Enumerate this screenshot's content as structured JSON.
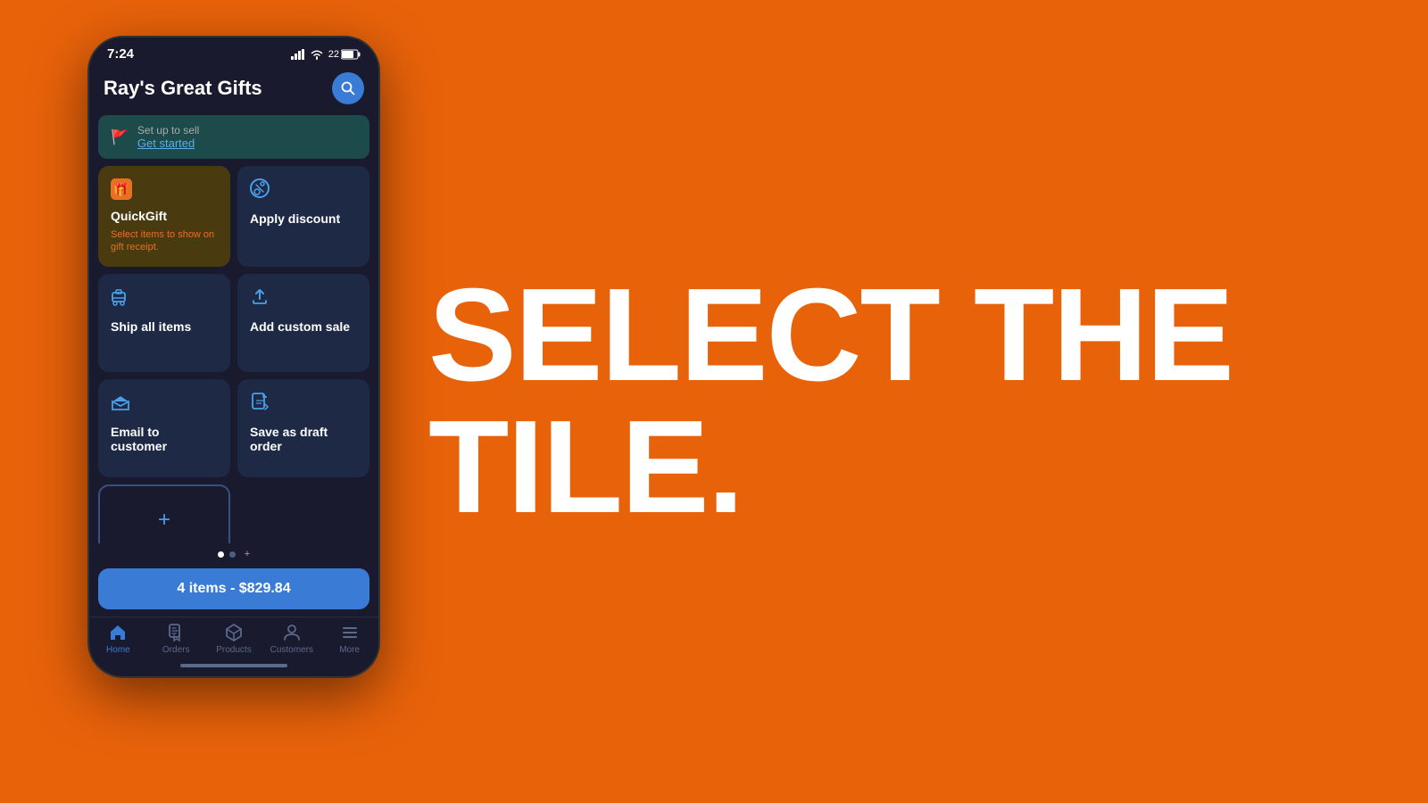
{
  "background_color": "#E8620A",
  "big_text": {
    "line1": "SELECT THE",
    "line2": "TILE."
  },
  "phone": {
    "status_bar": {
      "time": "7:24",
      "battery": "22"
    },
    "header": {
      "title": "Ray's Great Gifts",
      "search_label": "search"
    },
    "setup_banner": {
      "title": "Set up to sell",
      "link": "Get started"
    },
    "tiles": [
      {
        "id": "quick-gift",
        "icon": "gift",
        "title": "QuickGift",
        "subtitle": "Select items to show on gift receipt.",
        "variant": "quick-gift"
      },
      {
        "id": "apply-discount",
        "icon": "discount",
        "title": "Apply discount",
        "subtitle": ""
      },
      {
        "id": "ship-all-items",
        "icon": "ship",
        "title": "Ship all items",
        "subtitle": ""
      },
      {
        "id": "add-custom-sale",
        "icon": "upload",
        "title": "Add custom sale",
        "subtitle": ""
      },
      {
        "id": "email-to-customer",
        "icon": "email",
        "title": "Email to customer",
        "subtitle": ""
      },
      {
        "id": "save-as-draft",
        "icon": "draft",
        "title": "Save as draft order",
        "subtitle": ""
      }
    ],
    "add_tile_label": "+",
    "cart_button": "4 items - $829.84",
    "pagination": {
      "dots": 2,
      "active": 0
    },
    "bottom_nav": [
      {
        "id": "home",
        "label": "Home",
        "active": true,
        "icon": "home"
      },
      {
        "id": "orders",
        "label": "Orders",
        "active": false,
        "icon": "orders"
      },
      {
        "id": "products",
        "label": "Products",
        "active": false,
        "icon": "products"
      },
      {
        "id": "customers",
        "label": "Customers",
        "active": false,
        "icon": "customers"
      },
      {
        "id": "more",
        "label": "More",
        "active": false,
        "icon": "more"
      }
    ]
  }
}
